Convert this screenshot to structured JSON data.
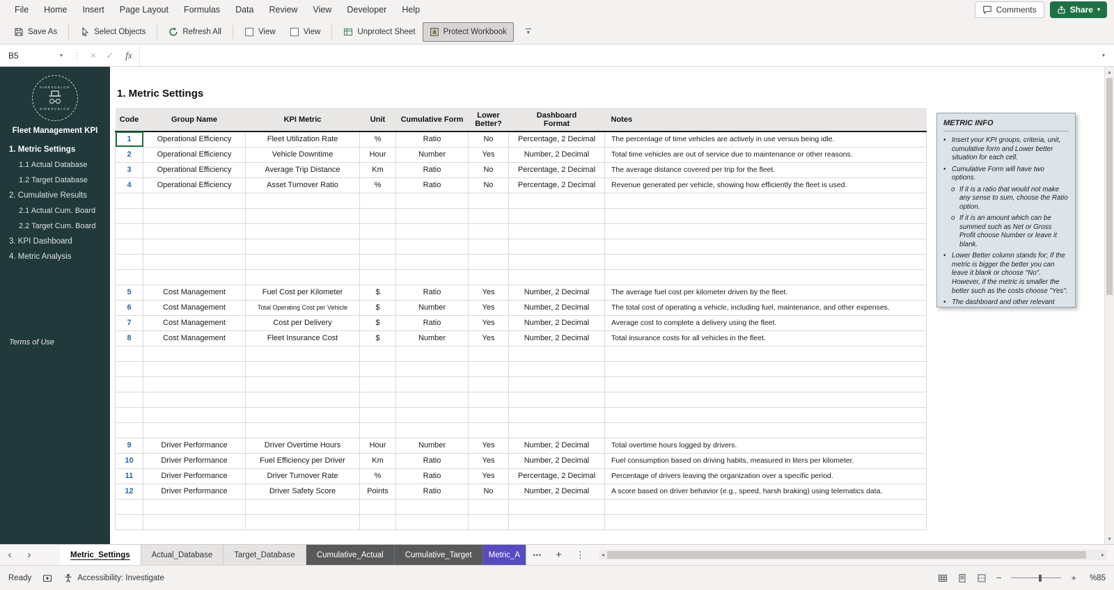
{
  "colors": {
    "accent_green": "#1e7145",
    "sidebar_bg": "#21393b",
    "code_blue": "#2563ab",
    "info_panel_bg": "#dce3e9",
    "tab_dark_bg": "#58595b",
    "tab_purple_bg": "#564bc1"
  },
  "icons": {
    "dropdown_chevron": "▾",
    "scroll_up": "▴",
    "scroll_down": "▾",
    "scroll_left": "◂",
    "scroll_right": "▸",
    "nav_left": "‹",
    "nav_right": "›",
    "more_sheets": "•••",
    "new_sheet": "+",
    "options_dots": "⋮",
    "cancel": "×",
    "enter": "✓",
    "zoom_out": "−",
    "zoom_in": "+"
  },
  "menu": {
    "items": [
      "File",
      "Home",
      "Insert",
      "Page Layout",
      "Formulas",
      "Data",
      "Review",
      "View",
      "Developer",
      "Help"
    ],
    "comments_label": "Comments",
    "share_label": "Share"
  },
  "toolbar": {
    "buttons": [
      {
        "label": "Save As",
        "icon": "save-as-icon",
        "sep_after": true
      },
      {
        "label": "Select Objects",
        "icon": "select-objects-icon",
        "sep_after": true
      },
      {
        "label": "Refresh All",
        "icon": "refresh-all-icon",
        "sep_after": true
      },
      {
        "label": "View",
        "icon": "checkbox-icon"
      },
      {
        "label": "View",
        "icon": "checkbox-icon",
        "sep_after": true
      },
      {
        "label": "Unprotect Sheet",
        "icon": "unprotect-sheet-icon"
      },
      {
        "label": "Protect Workbook",
        "icon": "protect-workbook-icon",
        "selected": true
      }
    ]
  },
  "formula_bar": {
    "cell_ref": "B5",
    "fx_label": "fx",
    "formula_value": ""
  },
  "sidebar": {
    "logo_text": "SIREXCELCO",
    "brand": "Fleet Management KPI",
    "items": [
      {
        "label": "1. Metric Settings",
        "level": 0,
        "active": true
      },
      {
        "label": "1.1 Actual Database",
        "level": 1
      },
      {
        "label": "1.2 Target Database",
        "level": 1
      },
      {
        "label": "2. Cumulative Results",
        "level": 0
      },
      {
        "label": "2.1 Actual Cum. Board",
        "level": 1
      },
      {
        "label": "2.2 Target Cum. Board",
        "level": 1
      },
      {
        "label": "3. KPI Dashboard",
        "level": 0
      },
      {
        "label": "4. Metric Analysis",
        "level": 0
      }
    ],
    "footer_link": "Terms of Use"
  },
  "sheet": {
    "title": "1. Metric Settings",
    "columns": [
      {
        "label": "Code"
      },
      {
        "label": "Group Name"
      },
      {
        "label": "KPI Metric"
      },
      {
        "label": "Unit"
      },
      {
        "label": "Cumulative Form"
      },
      {
        "label": "Lower\nBetter?"
      },
      {
        "label": "Dashboard\nFormat"
      },
      {
        "label": "Notes"
      }
    ],
    "rows": [
      {
        "code": "1",
        "group": "Operational Efficiency",
        "metric": "Fleet Utilization Rate",
        "unit": "%",
        "cumulative": "Ratio",
        "lower": "No",
        "format": "Percentage, 2 Decimal",
        "notes": "The percentage of time vehicles are actively in use versus being idle.",
        "selected": true
      },
      {
        "code": "2",
        "group": "Operational Efficiency",
        "metric": "Vehicle Downtime",
        "unit": "Hour",
        "cumulative": "Number",
        "lower": "Yes",
        "format": "Number, 2 Decimal",
        "notes": "Total time vehicles are out of service due to maintenance or other reasons."
      },
      {
        "code": "3",
        "group": "Operational Efficiency",
        "metric": "Average Trip Distance",
        "unit": "Km",
        "cumulative": "Ratio",
        "lower": "No",
        "format": "Percentage, 2 Decimal",
        "notes": "The average distance covered per trip for the fleet."
      },
      {
        "code": "4",
        "group": "Operational Efficiency",
        "metric": "Asset Turnover Ratio",
        "unit": "%",
        "cumulative": "Ratio",
        "lower": "No",
        "format": "Percentage, 2 Decimal",
        "notes": "Revenue generated per vehicle, showing how efficiently the fleet is used."
      },
      {},
      {},
      {},
      {},
      {},
      {},
      {
        "code": "5",
        "group": "Cost Management",
        "metric": "Fuel Cost per Kilometer",
        "unit": "$",
        "cumulative": "Ratio",
        "lower": "Yes",
        "format": "Number, 2 Decimal",
        "notes": "The average fuel cost per kilometer driven by the fleet."
      },
      {
        "code": "6",
        "group": "Cost Management",
        "metric": "Total Operating Cost per Vehicle",
        "unit": "$",
        "cumulative": "Number",
        "lower": "Yes",
        "format": "Number, 2 Decimal",
        "notes": "The total cost of operating a vehicle, including fuel, maintenance, and other expenses."
      },
      {
        "code": "7",
        "group": "Cost Management",
        "metric": "Cost per Delivery",
        "unit": "$",
        "cumulative": "Ratio",
        "lower": "Yes",
        "format": "Number, 2 Decimal",
        "notes": "Average cost to complete a delivery using the fleet."
      },
      {
        "code": "8",
        "group": "Cost Management",
        "metric": "Fleet Insurance Cost",
        "unit": "$",
        "cumulative": "Number",
        "lower": "Yes",
        "format": "Number, 2 Decimal",
        "notes": "Total insurance costs for all vehicles in the fleet."
      },
      {},
      {},
      {},
      {},
      {},
      {},
      {
        "code": "9",
        "group": "Driver Performance",
        "metric": "Driver Overtime Hours",
        "unit": "Hour",
        "cumulative": "Number",
        "lower": "Yes",
        "format": "Number, 2 Decimal",
        "notes": "Total overtime hours logged by drivers."
      },
      {
        "code": "10",
        "group": "Driver Performance",
        "metric": "Fuel Efficiency per Driver",
        "unit": "Km",
        "cumulative": "Ratio",
        "lower": "Yes",
        "format": "Number, 2 Decimal",
        "notes": "Fuel consumption based on driving habits, measured in liters per kilometer."
      },
      {
        "code": "11",
        "group": "Driver Performance",
        "metric": "Driver Turnover Rate",
        "unit": "%",
        "cumulative": "Ratio",
        "lower": "Yes",
        "format": "Percentage, 2 Decimal",
        "notes": "Percentage of drivers leaving the organization over a specific period."
      },
      {
        "code": "12",
        "group": "Driver Performance",
        "metric": "Driver Safety Score",
        "unit": "Points",
        "cumulative": "Ratio",
        "lower": "No",
        "format": "Number, 2 Decimal",
        "notes": "A score based on driver behavior (e.g., speed, harsh braking) using telematics data."
      },
      {},
      {}
    ]
  },
  "info_panel": {
    "title": "METRIC INFO",
    "items": [
      {
        "bullet": "•",
        "text": "Insert your KPI groups, criteria, unit, cumulative form and Lower better situation for each cell."
      },
      {
        "bullet": "•",
        "text": "Cumulative Form will have two options."
      },
      {
        "bullet": "o",
        "text": "If it is a ratio that would not make any sense to sum, choose the Ratio option."
      },
      {
        "bullet": "o",
        "text": "If it is an amount which can be summed such as Net or Gross Profit choose Number or leave it blank."
      },
      {
        "bullet": "•",
        "text": "Lower Better column stands for; If the metric is bigger the better you can leave it blank or choose \"No\". However, if the metric is smaller the better such as the costs choose \"Yes\"."
      },
      {
        "bullet": "•",
        "text": "The dashboard and other relevant"
      }
    ]
  },
  "sheet_tabs": {
    "tabs": [
      {
        "name": "Metric_Settings",
        "style": "active"
      },
      {
        "name": "Actual_Database",
        "style": "light"
      },
      {
        "name": "Target_Database",
        "style": "light"
      },
      {
        "name": "Cumulative_Actual",
        "style": "dark"
      },
      {
        "name": "Cumulative_Target",
        "style": "dark"
      },
      {
        "name": "Metric_A",
        "style": "purple"
      }
    ]
  },
  "status_bar": {
    "ready_label": "Ready",
    "accessibility_label": "Accessibility: Investigate",
    "zoom_label": "%85"
  }
}
